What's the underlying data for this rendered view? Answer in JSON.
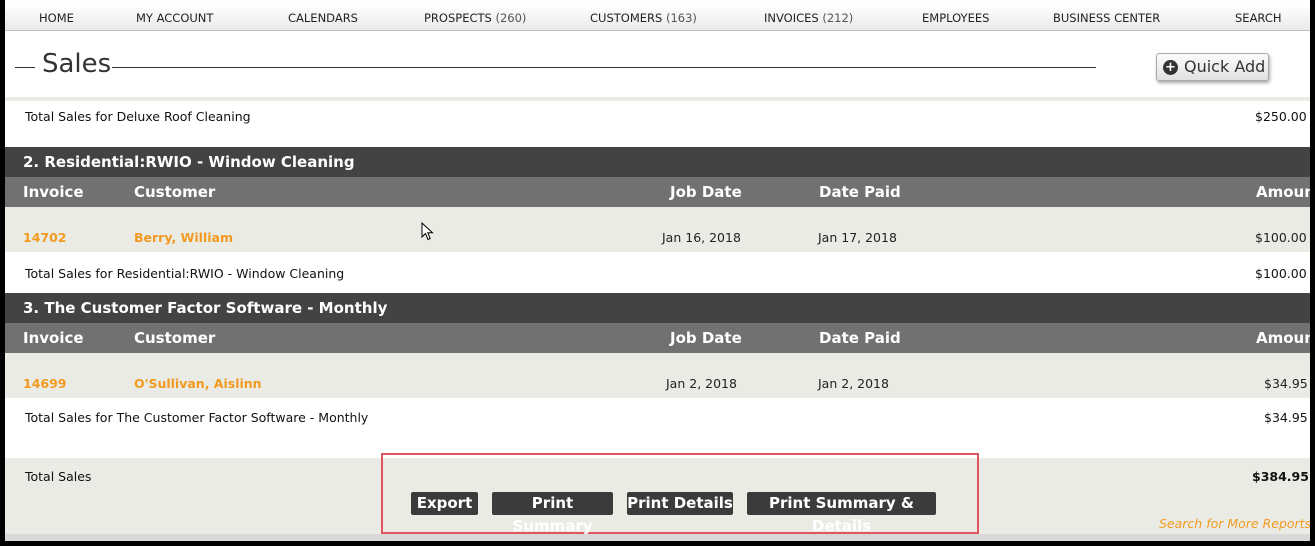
{
  "nav": {
    "items": [
      {
        "label": "HOME",
        "count": ""
      },
      {
        "label": "MY ACCOUNT",
        "count": ""
      },
      {
        "label": "CALENDARS",
        "count": ""
      },
      {
        "label": "PROSPECTS",
        "count": "(260)"
      },
      {
        "label": "CUSTOMERS",
        "count": "(163)"
      },
      {
        "label": "INVOICES",
        "count": "(212)"
      },
      {
        "label": "EMPLOYEES",
        "count": ""
      },
      {
        "label": "BUSINESS CENTER",
        "count": ""
      },
      {
        "label": "SEARCH",
        "count": ""
      }
    ]
  },
  "page": {
    "title": "Sales",
    "quick_add": "Quick Add",
    "quick_add_icon": "+"
  },
  "columns": {
    "invoice": "Invoice",
    "customer": "Customer",
    "job_date": "Job Date",
    "date_paid": "Date Paid",
    "amount": "Amount"
  },
  "sections": [
    {
      "total_label": "Total Sales for Deluxe Roof Cleaning",
      "total_amount": "$250.00"
    },
    {
      "heading": "2. Residential:RWIO - Window Cleaning",
      "row": {
        "invoice": "14702",
        "customer": "Berry, William",
        "job_date": "Jan 16, 2018",
        "date_paid": "Jan 17, 2018",
        "amount": "$100.00"
      },
      "total_label": "Total Sales for Residential:RWIO - Window Cleaning",
      "total_amount": "$100.00"
    },
    {
      "heading": "3. The Customer Factor Software - Monthly",
      "row": {
        "invoice": "14699",
        "customer": "O'Sullivan, Aislinn",
        "job_date": "Jan 2, 2018",
        "date_paid": "Jan 2, 2018",
        "amount": "$34.95"
      },
      "total_label": "Total Sales for The Customer Factor Software - Monthly",
      "total_amount": "$34.95"
    }
  ],
  "grand_total": {
    "label": "Total Sales",
    "amount": "$384.95"
  },
  "actions": {
    "export": "Export",
    "print_summary": "Print Summary",
    "print_details": "Print Details",
    "print_summary_details": "Print Summary & Details",
    "more_reports": "Search for More Reports"
  },
  "colors": {
    "accent_link": "#f29a1f",
    "section_header": "#434343",
    "column_header": "#717171",
    "row_background": "#ebebe5",
    "highlight_box": "#e05560"
  }
}
